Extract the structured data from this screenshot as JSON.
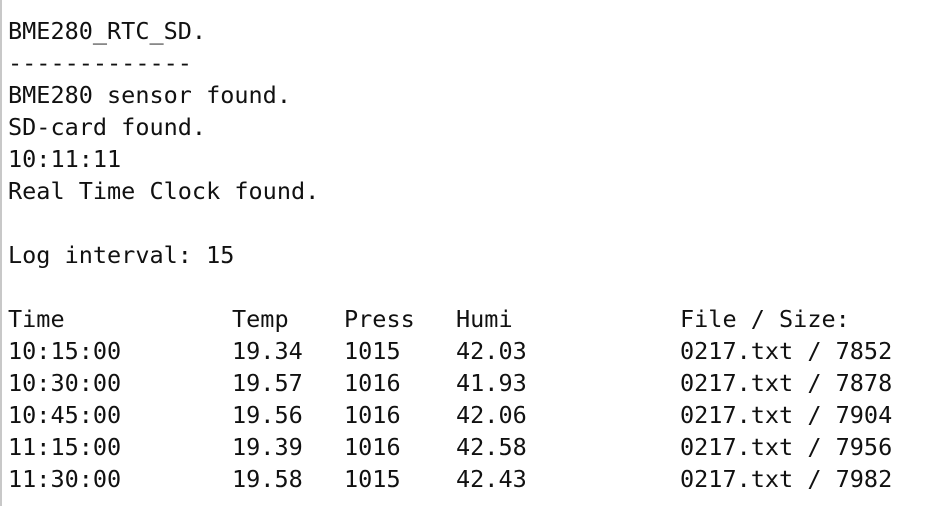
{
  "header": {
    "title": "BME280_RTC_SD.",
    "separator": "-------------"
  },
  "status_lines": [
    "BME280 sensor found.",
    "SD-card found.",
    "10:11:11",
    "Real Time Clock found."
  ],
  "log_interval": "Log interval: 15",
  "table": {
    "columns": [
      "Time",
      "Temp",
      "Press",
      "Humi",
      "File / Size:"
    ],
    "rows": [
      [
        "10:15:00",
        "19.34",
        "1015",
        "42.03",
        "0217.txt / 7852"
      ],
      [
        "10:30:00",
        "19.57",
        "1016",
        "41.93",
        "0217.txt / 7878"
      ],
      [
        "10:45:00",
        "19.56",
        "1016",
        "42.06",
        "0217.txt / 7904"
      ],
      [
        "11:15:00",
        "19.39",
        "1016",
        "42.58",
        "0217.txt / 7956"
      ],
      [
        "11:30:00",
        "19.58",
        "1015",
        "42.43",
        "0217.txt / 7982"
      ]
    ]
  }
}
